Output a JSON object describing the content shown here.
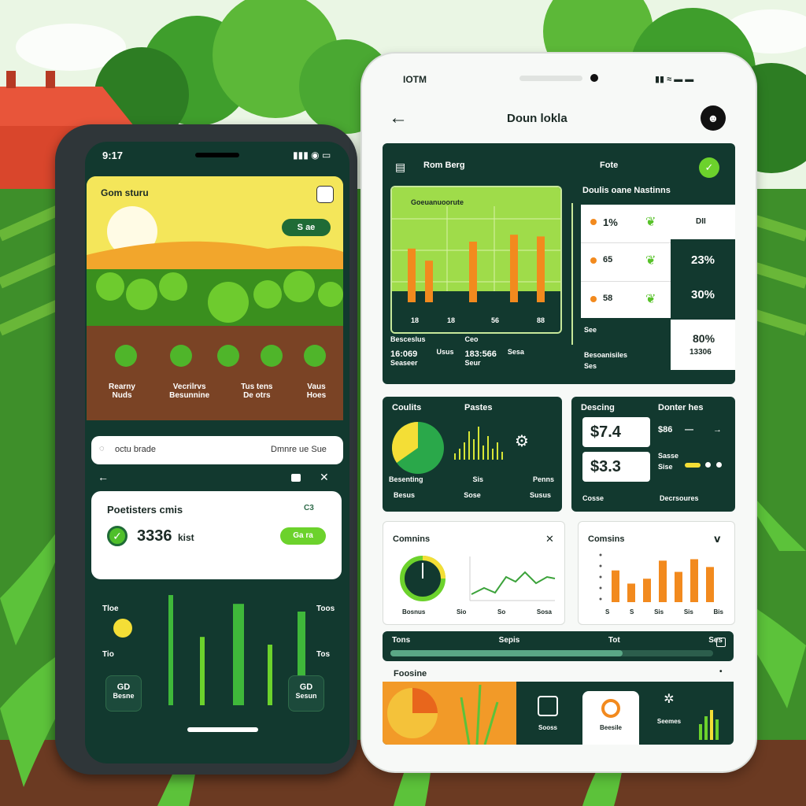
{
  "left_phone": {
    "status_time": "9:17",
    "header_title": "Gom sturu",
    "header_button": "S ae",
    "plants": [
      {
        "line1": "Rearny",
        "line2": "Nuds"
      },
      {
        "line1": "Vecrilrvs",
        "line2": "Besunnine"
      },
      {
        "line1": "Tus tens",
        "line2": "De otrs"
      },
      {
        "line1": "Vaus",
        "line2": "Hoes"
      }
    ],
    "search_left": "octu brade",
    "search_right": "Dmnre ue  Sue",
    "card_title": "Poetisters cmis",
    "card_code": "C3",
    "card_value": "3336",
    "card_unit": "kist",
    "card_button": "Ga ra",
    "chart_labels": {
      "tl": "Tloe",
      "ml": "Tio",
      "tr": "Toos",
      "mr": "Tos"
    },
    "chart_bars": [
      1.0,
      0.62,
      0.92,
      0.55,
      0.85
    ],
    "bottom_left": {
      "top": "GD",
      "bottom": "Besne"
    },
    "bottom_right": {
      "top": "GD",
      "bottom": "Sesun"
    }
  },
  "right_phone": {
    "status_time": "IOTM",
    "page_title": "Doun lokla",
    "section_title": "Rom Berg",
    "section_right": "Fote",
    "chart_title": "Goeuanuoorute",
    "chart_ticks": [
      "18",
      "18",
      "56",
      "88"
    ],
    "chart_bars": [
      0.62,
      0.48,
      0.7,
      0.78,
      0.76
    ],
    "chart_footer": [
      {
        "label": "Besceslus",
        "value": "16:069",
        "sub": "Seaseer"
      },
      {
        "label": "Usus",
        "value": "",
        "sub": ""
      },
      {
        "label": "Ceo",
        "value": "183:566",
        "sub": "Seur"
      },
      {
        "label": "Sesa",
        "value": "",
        "sub": ""
      }
    ],
    "metrics_title": "Doulis oane Nastinns",
    "metrics_side": "DII",
    "metrics_rows": [
      {
        "label": "1%",
        "pct": "23%"
      },
      {
        "label": "65",
        "pct": "30%"
      },
      {
        "label": "58",
        "pct": ""
      }
    ],
    "metrics_footer_left": "See",
    "metrics_footer_mid": "Besoanisiles",
    "metrics_footer_sub": "Ses",
    "metrics_big_pct": "80%",
    "metrics_big_num": "13306",
    "pie_card": {
      "title": "Coulits",
      "title2": "Pastes",
      "labels": [
        "Besenting",
        "Sis",
        "Penns"
      ],
      "footer": [
        "Besus",
        "Sose",
        "Susus"
      ]
    },
    "price_card": {
      "title": "Descing",
      "title2": "Donter hes",
      "price1": "$7.4",
      "price2": "$3.3",
      "side1": "$86",
      "side2": "Sasse",
      "side3": "Sise",
      "footer1": "Cosse",
      "footer2": "Decrsoures"
    },
    "gauge_card": {
      "title": "Comnins",
      "labels": [
        "Bosnus",
        "Sio",
        "So",
        "Sosa"
      ]
    },
    "bar_card": {
      "title": "Comsins",
      "bars": [
        0.65,
        0.38,
        0.48,
        0.85,
        0.62,
        0.88,
        0.72
      ],
      "labels": [
        "S",
        "S",
        "Sis",
        "Sis",
        "Bis"
      ]
    },
    "progress_bar": {
      "labels": [
        "Tons",
        "Sepis",
        "Tot",
        "Ses"
      ],
      "fill": 0.72
    },
    "footer_section": "Foosine",
    "bottom_nav": [
      "Sooss",
      "Beesile",
      "Seemes"
    ],
    "colors": {
      "dark_green": "#12392f",
      "lime": "#8fd43a",
      "orange": "#f28a1e"
    }
  }
}
